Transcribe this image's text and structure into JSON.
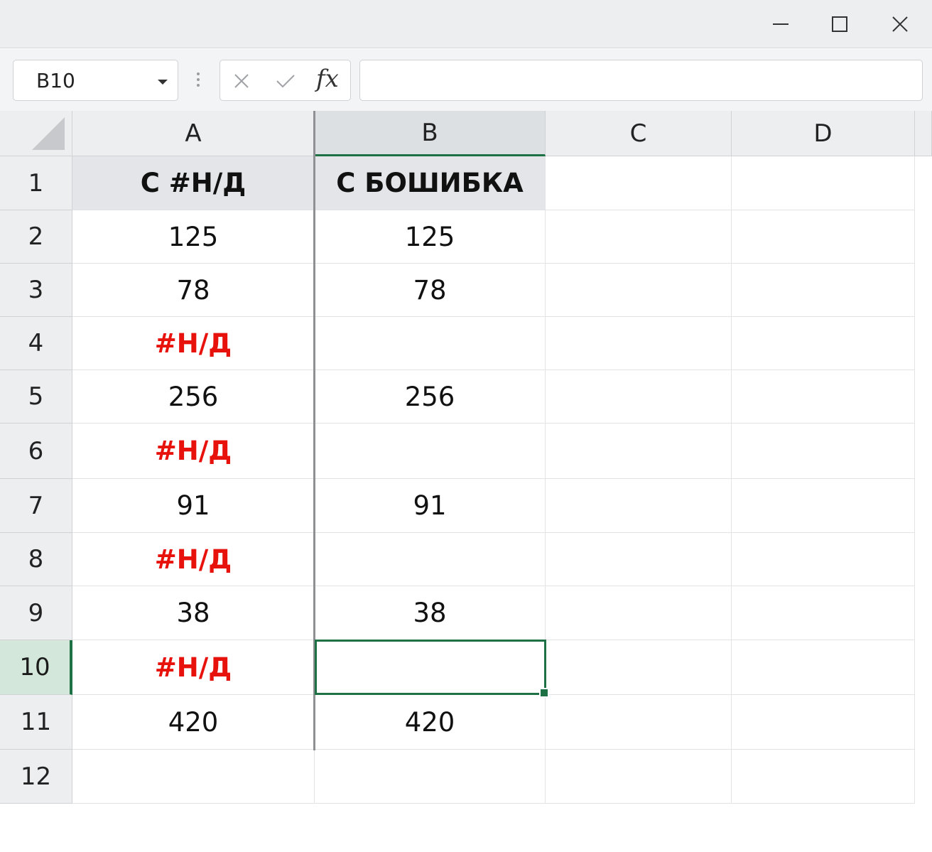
{
  "window": {
    "controls": [
      "minimize-icon",
      "maximize-icon",
      "close-icon"
    ]
  },
  "formula_bar": {
    "name_box": "B10",
    "cancel_icon": "x-icon",
    "enter_icon": "check-icon",
    "fx_label": "fx",
    "formula": ""
  },
  "sheet": {
    "columns": [
      "A",
      "B",
      "C",
      "D"
    ],
    "rows": [
      "1",
      "2",
      "3",
      "4",
      "5",
      "6",
      "7",
      "8",
      "9",
      "10",
      "11",
      "12"
    ],
    "selected_cell": "B10",
    "cells": {
      "A": [
        "С #Н/Д",
        "125",
        "78",
        "#Н/Д",
        "256",
        "#Н/Д",
        "91",
        "#Н/Д",
        "38",
        "#Н/Д",
        "420",
        ""
      ],
      "B": [
        "С БОШИБКА",
        "125",
        "78",
        "",
        "256",
        "",
        "91",
        "",
        "38",
        "",
        "420",
        ""
      ],
      "C": [
        "",
        "",
        "",
        "",
        "",
        "",
        "",
        "",
        "",
        "",
        "",
        ""
      ],
      "D": [
        "",
        "",
        "",
        "",
        "",
        "",
        "",
        "",
        "",
        "",
        "",
        ""
      ]
    }
  },
  "colors": {
    "error_text": "#e8120c",
    "selection": "#1e7145",
    "header_fill": "#e3e5e8"
  }
}
